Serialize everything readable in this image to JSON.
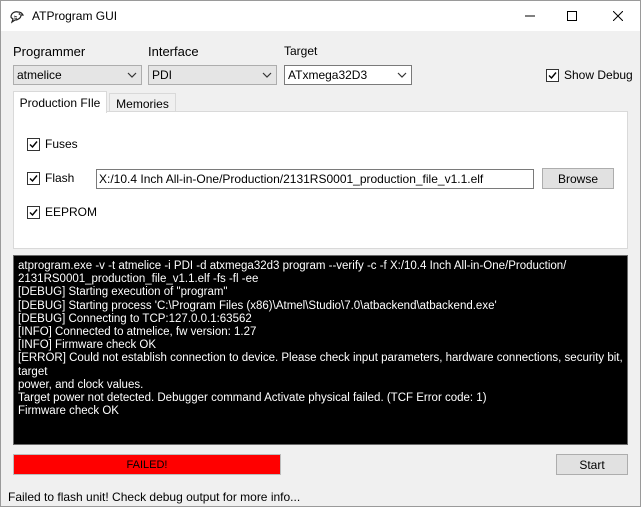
{
  "window": {
    "title": "ATProgram GUI"
  },
  "icons": {
    "app": "bird-icon",
    "minimize": "minimize-icon",
    "maximize": "maximize-icon",
    "close": "close-icon",
    "dropdown": "chevron-down-icon",
    "check": "check-icon"
  },
  "programmer": {
    "label": "Programmer",
    "value": "atmelice"
  },
  "interface": {
    "label": "Interface",
    "value": "PDI"
  },
  "target": {
    "label": "Target",
    "value": "ATxmega32D3"
  },
  "show_debug": {
    "label": "Show Debug",
    "checked": true
  },
  "tabs": [
    {
      "label": "Production FIle",
      "active": true
    },
    {
      "label": "Memories",
      "active": false
    }
  ],
  "memories": {
    "fuses": {
      "label": "Fuses",
      "checked": true
    },
    "flash": {
      "label": "Flash",
      "checked": true,
      "path": "X:/10.4 Inch All-in-One/Production/2131RS0001_production_file_v1.1.elf"
    },
    "eeprom": {
      "label": "EEPROM",
      "checked": true
    }
  },
  "browse_label": "Browse",
  "console": {
    "lines": [
      "atprogram.exe -v -t atmelice -i PDI -d atxmega32d3 program --verify -c -f X:/10.4 Inch All-in-One/Production/",
      "2131RS0001_production_file_v1.1.elf -fs -fl -ee",
      "[DEBUG] Starting execution of \"program\"",
      "[DEBUG] Starting process 'C:\\Program Files (x86)\\Atmel\\Studio\\7.0\\atbackend\\atbackend.exe'",
      "[DEBUG] Connecting to TCP:127.0.0.1:63562",
      "[INFO] Connected to atmelice, fw version: 1.27",
      "[INFO] Firmware check OK",
      "[ERROR] Could not establish connection to device. Please check input parameters, hardware connections, security bit, target",
      "power, and clock values.",
      "Target power not detected. Debugger command Activate physical failed. (TCF Error code: 1)",
      "Firmware check OK"
    ]
  },
  "status": {
    "text": "FAILED!",
    "color": "#ff0000"
  },
  "start_label": "Start",
  "footer_message": "Failed to flash unit! Check debug output for more info..."
}
